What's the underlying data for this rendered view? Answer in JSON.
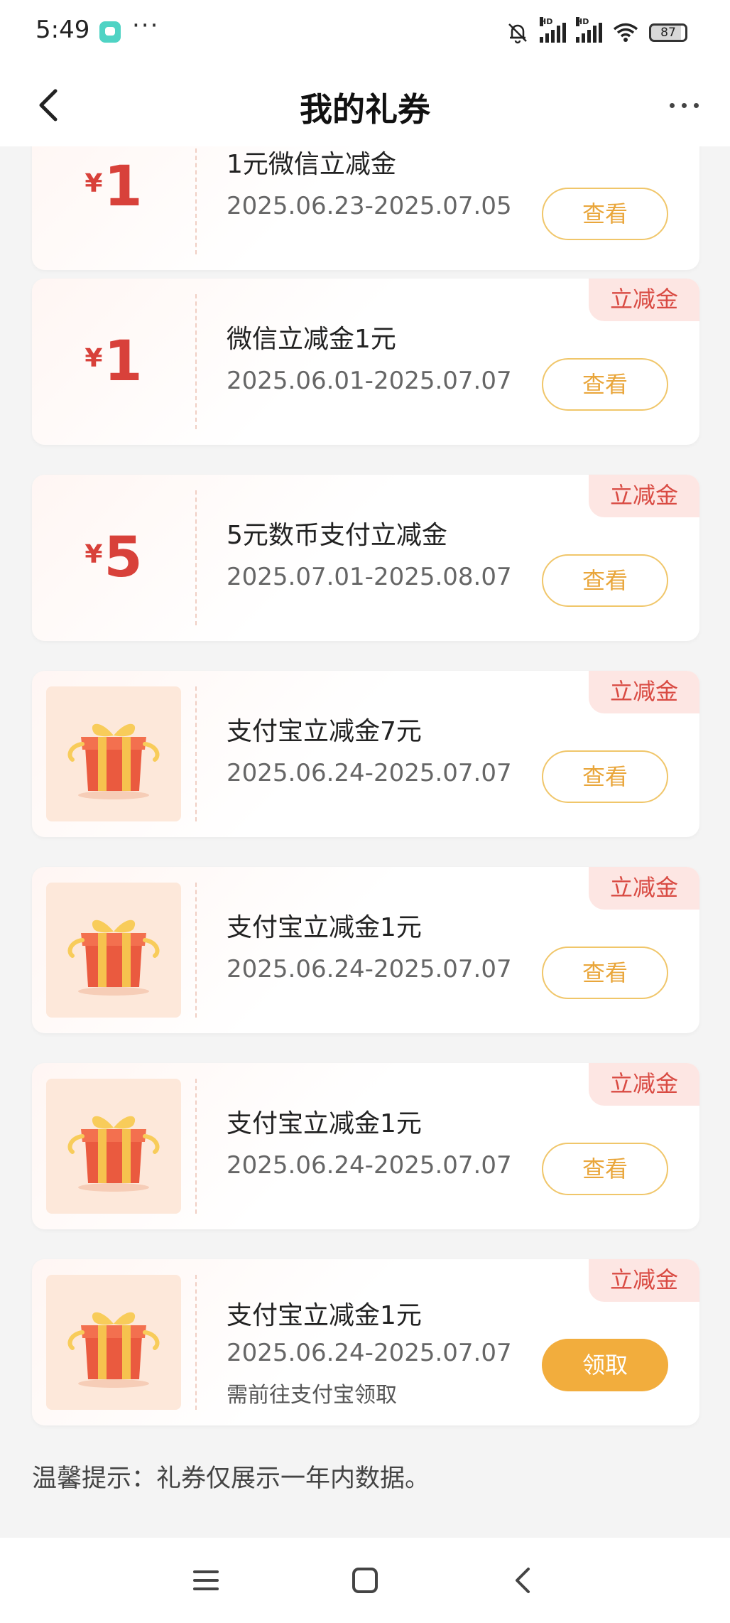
{
  "status_bar": {
    "time": "5:49",
    "more_dots": "···",
    "signal_label_1": "HD",
    "signal_label_2": "HD",
    "battery": "87"
  },
  "header": {
    "title": "我的礼券"
  },
  "colors": {
    "accent_red": "#d8413a",
    "button_gold": "#f2ad3d",
    "button_outline": "#f0c66a",
    "tag_bg": "#fde6e3"
  },
  "coupons": [
    {
      "type": "amount",
      "currency": "¥",
      "amount": "1",
      "title": "1元微信立减金",
      "date": "2025.06.23-2025.07.05",
      "action": "查看"
    },
    {
      "type": "amount",
      "currency": "¥",
      "amount": "1",
      "tag": "立减金",
      "title": "微信立减金1元",
      "date": "2025.06.01-2025.07.07",
      "action": "查看"
    },
    {
      "type": "amount",
      "currency": "¥",
      "amount": "5",
      "tag": "立减金",
      "title": "5元数币支付立减金",
      "date": "2025.07.01-2025.08.07",
      "action": "查看"
    },
    {
      "type": "gift",
      "icon": "gift-box-icon",
      "tag": "立减金",
      "title": "支付宝立减金7元",
      "date": "2025.06.24-2025.07.07",
      "action": "查看"
    },
    {
      "type": "gift",
      "icon": "gift-box-icon",
      "tag": "立减金",
      "title": "支付宝立减金1元",
      "date": "2025.06.24-2025.07.07",
      "action": "查看"
    },
    {
      "type": "gift",
      "icon": "gift-box-icon",
      "tag": "立减金",
      "title": "支付宝立减金1元",
      "date": "2025.06.24-2025.07.07",
      "action": "查看"
    },
    {
      "type": "gift",
      "icon": "gift-box-icon",
      "tag": "立减金",
      "title": "支付宝立减金1元",
      "date": "2025.06.24-2025.07.07",
      "note": "需前往支付宝领取",
      "action": "领取"
    }
  ],
  "tip": "温馨提示：礼券仅展示一年内数据。",
  "nav": {
    "menu_icon": "menu-icon",
    "home_icon": "home-icon",
    "back_icon": "back-icon"
  }
}
